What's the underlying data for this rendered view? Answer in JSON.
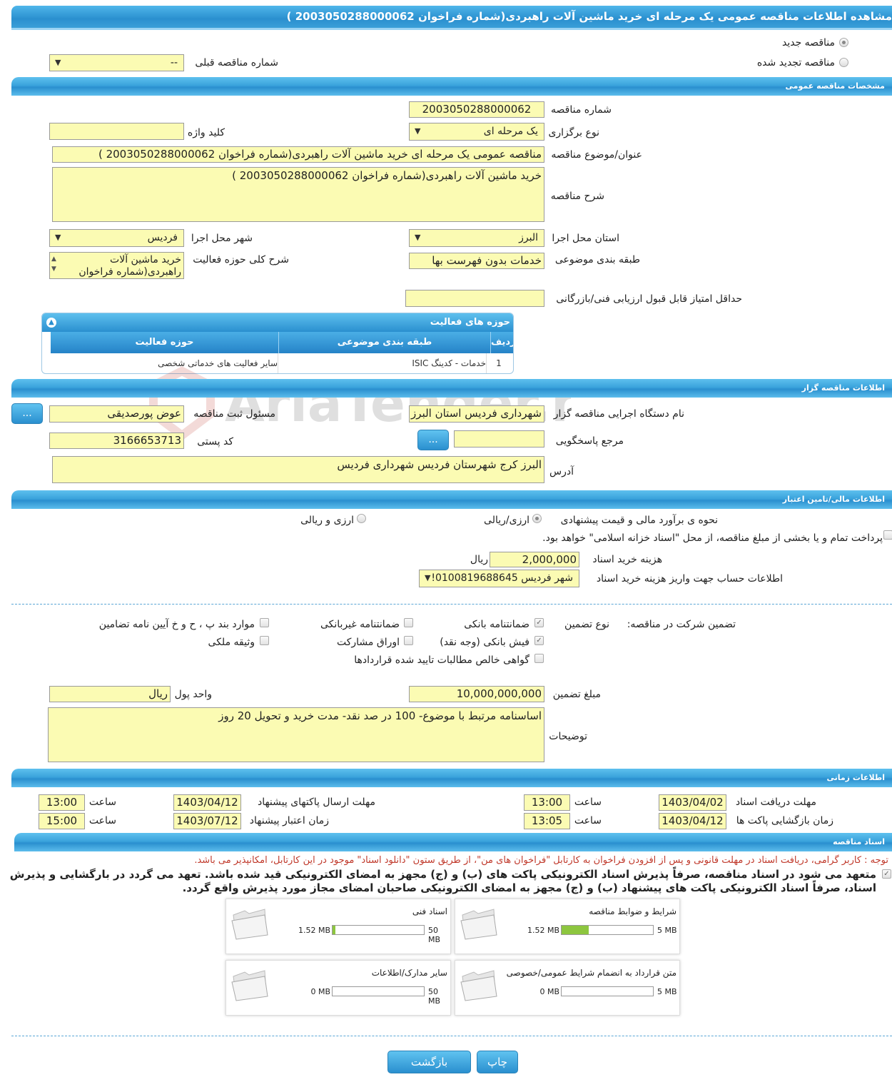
{
  "page_title": "مشاهده اطلاعات مناقصه عمومی یک مرحله ای خرید ماشین آلات راهبردی(شماره فراخوان 2003050288000062 )",
  "tender_type": {
    "new_label": "مناقصه جدید",
    "renewed_label": "مناقصه تجدید شده",
    "previous_label": "شماره مناقصه قبلی",
    "previous_value": "--"
  },
  "general": {
    "section": "مشخصات مناقصه عمومی",
    "number_label": "شماره مناقصه",
    "number": "2003050288000062",
    "keyword_label": "کلید واژه",
    "keyword": "",
    "holding_type_label": "نوع برگزاری",
    "holding_type": "یک مرحله ای",
    "title_label": "عنوان/موضوع مناقصه",
    "title": "مناقصه عمومی یک مرحله ای خرید ماشین آلات راهبردی(شماره فراخوان 2003050288000062 )",
    "desc_label": "شرح مناقصه",
    "desc": "خرید ماشین آلات راهبردی(شماره فراخوان 2003050288000062 )",
    "province_label": "استان محل اجرا",
    "province": "البرز",
    "city_label": "شهر محل اجرا",
    "city": "فردیس",
    "category_label": "طبقه بندی موضوعی",
    "category": "خدمات بدون فهرست بها",
    "activity_desc_label": "شرح کلی حوزه فعالیت",
    "activity_desc": "خرید ماشین آلات راهبردی(شماره فراخوان",
    "min_score_label": "حداقل امتیاز قابل قبول ارزیابی فنی/بازرگانی",
    "min_score": ""
  },
  "activity_table": {
    "title": "حوزه های فعالیت",
    "cols": [
      "ردیف",
      "طبقه بندی موضوعی",
      "حوزه فعالیت"
    ],
    "rows": [
      {
        "idx": "1",
        "cat": "خدمات - کدینگ ISIC",
        "field": "سایر فعالیت های خدماتی شخصی"
      }
    ]
  },
  "watermark": "AriaTender.neT",
  "organizer": {
    "section": "اطلاعات مناقصه گزار",
    "org_label": "نام دستگاه اجرایی مناقصه گزار",
    "org": "شهرداری فردیس استان البرز",
    "reg_label": "مسئول ثبت مناقصه",
    "reg": "عوض پورصدیقی",
    "ref_label": "مرجع پاسخگویی",
    "ref": "",
    "postal_label": "کد پستی",
    "postal": "3166653713",
    "address_label": "آدرس",
    "address": "البرز کرج شهرستان فردیس شهرداری فردیس",
    "btn": "..."
  },
  "financial": {
    "section": "اطلاعات مالی/تامین اعتبار",
    "method_label": "نحوه ی برآورد مالی و قیمت پیشنهادی",
    "opt1": "ارزی/ریالی",
    "opt2": "ارزی و ریالی",
    "treasury_text": "پرداخت تمام و یا بخشی از مبلغ مناقصه، از محل \"اسناد خزانه اسلامی\" خواهد بود.",
    "doc_fee_label": "هزینه خرید اسناد",
    "doc_fee": "2,000,000",
    "doc_fee_unit": "ریال",
    "account_label": "اطلاعات حساب جهت واریز هزینه خرید اسناد",
    "account": "شهر فردیس 0100819688645!"
  },
  "guarantee": {
    "label": "تضمین شرکت در مناقصه:",
    "type_label": "نوع تضمین",
    "items": [
      "ضمانتنامه بانکی",
      "ضمانتنامه غیربانکی",
      "موارد بند پ ، ح و خ آیین نامه تضامین",
      "فیش بانکی (وجه نقد)",
      "اوراق مشارکت",
      "وثیقه ملکی",
      "گواهی خالص مطالبات تایید شده قراردادها"
    ],
    "amount_label": "مبلغ تضمین",
    "amount": "10,000,000,000",
    "unit_label": "واحد پول",
    "unit": "ریال",
    "notes_label": "توضیحات",
    "notes": "اساسنامه مرتبط با موضوع- 100 در صد نقد- مدت خرید و تحویل 20 روز"
  },
  "timing": {
    "section": "اطلاعات زمانی",
    "doc_deadline_label": "مهلت دریافت اسناد",
    "doc_deadline": "1403/04/02",
    "t1": "13:00",
    "send_deadline_label": "مهلت ارسال پاکتهای پیشنهاد",
    "send_deadline": "1403/04/12",
    "t2": "13:00",
    "open_label": "زمان بازگشایی پاکت ها",
    "open": "1403/04/12",
    "t3": "13:05",
    "valid_label": "زمان اعتبار پیشنهاد",
    "valid": "1403/07/12",
    "t4": "15:00",
    "time_label": "ساعت"
  },
  "documents": {
    "section": "اسناد مناقصه",
    "notice": "توجه : کاربر گرامی، دریافت اسناد در مهلت قانونی و پس از افزودن فراخوان به کارتابل \"فراخوان های من\"، از طریق ستون \"دانلود اسناد\" موجود در این کارتابل، امکانپذیر می باشد.",
    "commitment": "متعهد می شود در اسناد مناقصه، صرفاً پذیرش اسناد الکترونیکی پاکت های (ب) و (ج) مجهز به امضای الکترونیکی قید شده باشد. تعهد می گردد در بارگشایی و پذیرش اسناد، صرفاً اسناد الکترونیکی پاکت های پیشنهاد (ب) و (ج) مجهز به امضای الکترونیکی صاحبان امضای مجاز مورد پذیرش واقع گردد.",
    "files": [
      {
        "name": "شرایط و ضوابط مناقصه",
        "used": "1.52 MB",
        "max": "5 MB",
        "fill": 0.3
      },
      {
        "name": "اسناد فنی",
        "used": "1.52 MB",
        "max": "50 MB",
        "fill": 0.03
      },
      {
        "name": "متن قرارداد به انضمام شرایط عمومی/خصوصی",
        "used": "0 MB",
        "max": "5 MB",
        "fill": 0
      },
      {
        "name": "سایر مدارک/اطلاعات",
        "used": "0 MB",
        "max": "50 MB",
        "fill": 0
      }
    ]
  },
  "buttons": {
    "print": "چاپ",
    "back": "بازگشت"
  }
}
